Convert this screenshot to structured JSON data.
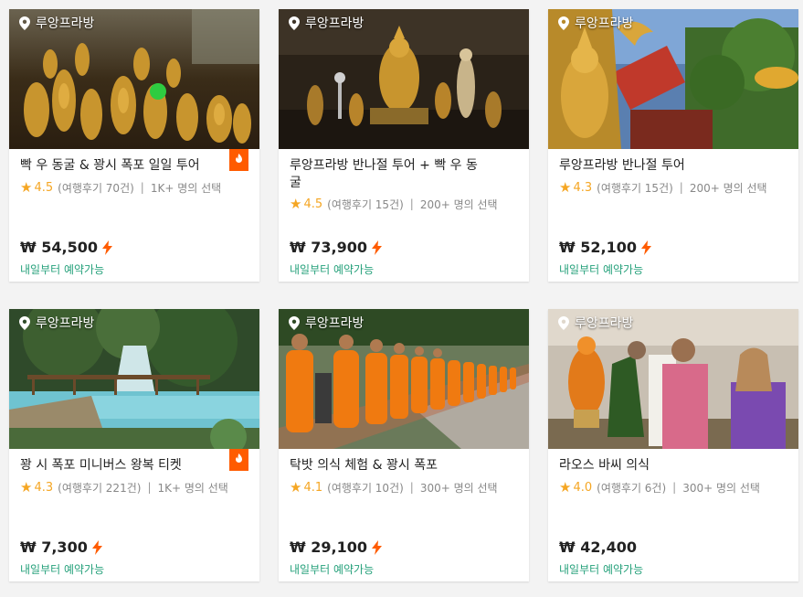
{
  "cards": [
    {
      "location": "루앙프라방",
      "title": "빡 우 동굴 & 꽝시 폭포 일일 투어",
      "rating": "4.5",
      "reviews": "(여행후기 70건)",
      "selected": "1K+ 명의 선택",
      "price": "₩ 54,500",
      "instant": true,
      "badge": true,
      "availability": "내일부터 예약가능",
      "image": "buddha-cave-statues"
    },
    {
      "location": "루앙프라방",
      "title": "루앙프라방 반나절 투어 + 빡 우 동굴",
      "rating": "4.5",
      "reviews": "(여행후기 15건)",
      "selected": "200+ 명의 선택",
      "price": "₩ 73,900",
      "instant": true,
      "badge": false,
      "availability": "내일부터 예약가능",
      "image": "golden-buddha-shrine"
    },
    {
      "location": "루앙프라방",
      "title": "루앙프라방 반나절 투어",
      "rating": "4.3",
      "reviews": "(여행후기 15건)",
      "selected": "200+ 명의 선택",
      "price": "₩ 52,100",
      "instant": true,
      "badge": false,
      "availability": "내일부터 예약가능",
      "image": "naga-buddha-temple"
    },
    {
      "location": "루앙프라방",
      "title": "꽝 시 폭포 미니버스 왕복 티켓",
      "rating": "4.3",
      "reviews": "(여행후기 221건)",
      "selected": "1K+ 명의 선택",
      "price": "₩ 7,300",
      "instant": true,
      "badge": true,
      "availability": "내일부터 예약가능",
      "image": "kuang-si-waterfall"
    },
    {
      "location": "루앙프라방",
      "title": "탁밧 의식 체험 & 꽝시 폭포",
      "rating": "4.1",
      "reviews": "(여행후기 10건)",
      "selected": "300+ 명의 선택",
      "price": "₩ 29,100",
      "instant": true,
      "badge": false,
      "availability": "내일부터 예약가능",
      "image": "monks-alms-procession"
    },
    {
      "location": "루앙프라방",
      "title": "라오스 바씨 의식",
      "rating": "4.0",
      "reviews": "(여행후기 6건)",
      "selected": "300+ 명의 선택",
      "price": "₩ 42,400",
      "instant": false,
      "badge": false,
      "availability": "내일부터 예약가능",
      "image": "baci-ceremony"
    }
  ],
  "colors": {
    "star": "#f5a623",
    "availability": "#26a17b",
    "instant": "#ff5b00",
    "badge": "#ff5b00"
  },
  "icons": {
    "location": "map-pin-icon",
    "rating": "star-icon",
    "instant": "lightning-icon",
    "badge": "fire-badge-icon"
  }
}
